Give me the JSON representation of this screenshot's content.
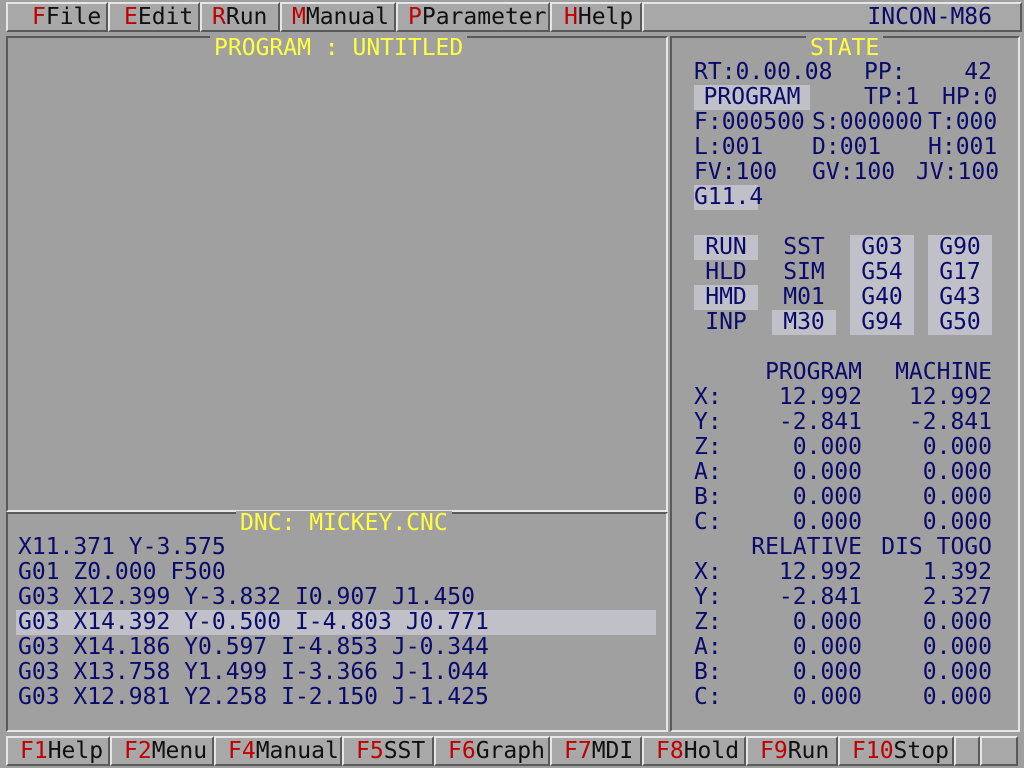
{
  "menu": {
    "file": {
      "key": "F",
      "label": "File"
    },
    "edit": {
      "key": "E",
      "label": "Edit"
    },
    "run": {
      "key": "R",
      "label": "Run"
    },
    "manual": {
      "key": "M",
      "label": "Manual"
    },
    "param": {
      "key": "P",
      "label": "Parameter"
    },
    "help": {
      "key": "H",
      "label": "Help"
    },
    "brand": "INCON-M86"
  },
  "program_panel": {
    "title": "PROGRAM : UNTITLED"
  },
  "dnc_panel": {
    "title": "DNC: MICKEY.CNC",
    "lines": [
      "X11.371 Y-3.575",
      "G01 Z0.000 F500",
      "G03 X12.399 Y-3.832 I0.907 J1.450",
      "G03 X14.392 Y-0.500 I-4.803 J0.771",
      "G03 X14.186 Y0.597 I-4.853 J-0.344",
      "G03 X13.758 Y1.499 I-3.366 J-1.044",
      "G03 X12.981 Y2.258 I-2.150 J-1.425"
    ]
  },
  "state": {
    "title": "STATE",
    "rt": "RT:0.00.08",
    "pp_label": "PP:",
    "pp_value": "42",
    "mode": "PROGRAM",
    "tp": "TP:1",
    "hp": "HP:0",
    "f": "F:000500",
    "s": "S:000000",
    "t": "T:000",
    "l": "L:001",
    "d": "D:001",
    "h": "H:001",
    "fv": "FV:100",
    "gv": "GV:100",
    "jv": "JV:100",
    "gcode": "G11.4",
    "flags": {
      "c1": [
        "RUN",
        "HLD",
        "HMD",
        "INP"
      ],
      "c2": [
        "SST",
        "SIM",
        "M01",
        "M30"
      ],
      "c3": [
        "G03",
        "G54",
        "G40",
        "G94"
      ],
      "c4": [
        "G90",
        "G17",
        "G43",
        "G50"
      ]
    },
    "coords": {
      "hdr1a": "PROGRAM",
      "hdr1b": "MACHINE",
      "hdr2a": "RELATIVE",
      "hdr2b": "DIS TOGO",
      "axes": [
        "X:",
        "Y:",
        "Z:",
        "A:",
        "B:",
        "C:"
      ],
      "program": [
        "12.992",
        "-2.841",
        "0.000",
        "0.000",
        "0.000",
        "0.000"
      ],
      "machine": [
        "12.992",
        "-2.841",
        "0.000",
        "0.000",
        "0.000",
        "0.000"
      ],
      "relative": [
        "12.992",
        "-2.841",
        "0.000",
        "0.000",
        "0.000",
        "0.000"
      ],
      "distogo": [
        "1.392",
        "2.327",
        "0.000",
        "0.000",
        "0.000",
        "0.000"
      ]
    }
  },
  "fkeys": {
    "f1": {
      "key": "F1",
      "label": "Help"
    },
    "f2": {
      "key": "F2",
      "label": "Menu"
    },
    "f4": {
      "key": "F4",
      "label": "Manual"
    },
    "f5": {
      "key": "F5",
      "label": "SST"
    },
    "f6": {
      "key": "F6",
      "label": "Graph"
    },
    "f7": {
      "key": "F7",
      "label": "MDI"
    },
    "f8": {
      "key": "F8",
      "label": "Hold"
    },
    "f9": {
      "key": "F9",
      "label": "Run"
    },
    "f10": {
      "key": "F10",
      "label": "Stop"
    }
  },
  "colors": {
    "background": "#a0a0a0",
    "title": "#ffff40",
    "text": "#0a0a6a",
    "hotkey": "#c00000"
  }
}
